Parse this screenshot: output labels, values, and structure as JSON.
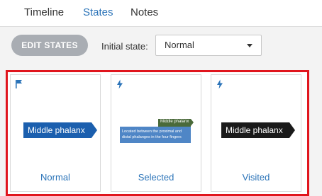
{
  "tabs": {
    "timeline": "Timeline",
    "states": "States",
    "notes": "Notes",
    "active": "States"
  },
  "toolbar": {
    "edit_states_label": "EDIT STATES",
    "initial_state_label": "Initial state:",
    "initial_state_value": "Normal"
  },
  "states": [
    {
      "label": "Normal",
      "icon": "flag-icon",
      "preview_text": "Middle phalanx",
      "preview_color": "#1b5fae"
    },
    {
      "label": "Selected",
      "icon": "lightning-icon",
      "preview_text": "Middle phalanx",
      "preview_detail": "Located between the proximal and distal phalanges in the four fingers",
      "preview_color": "#4f86c6",
      "tag_color": "#4a6a3a"
    },
    {
      "label": "Visited",
      "icon": "lightning-icon",
      "preview_text": "Middle phalanx",
      "preview_color": "#1a1a1a"
    }
  ],
  "colors": {
    "accent": "#2a73b8",
    "highlight_border": "#e0151d",
    "button_bg": "#a9adb3"
  }
}
